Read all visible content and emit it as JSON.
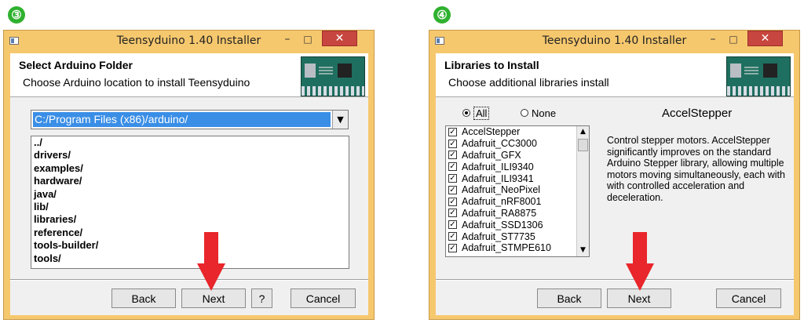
{
  "steps": [
    "③",
    "④"
  ],
  "windows": [
    {
      "title": "Teensyduino 1.40 Installer",
      "controls": {
        "minimize": "–",
        "maximize": "□",
        "close": "✕"
      },
      "header_title": "Select Arduino Folder",
      "header_subtitle": "Choose Arduino location to install Teensyduino",
      "path_value": "C:/Program Files (x86)/arduino/",
      "dropdown_arrow": "▼",
      "folders": [
        "../",
        "drivers/",
        "examples/",
        "hardware/",
        "java/",
        "lib/",
        "libraries/",
        "reference/",
        "tools-builder/",
        "tools/"
      ],
      "buttons": {
        "back": "Back",
        "next": "Next",
        "help": "?",
        "cancel": "Cancel"
      }
    },
    {
      "title": "Teensyduino 1.40 Installer",
      "controls": {
        "minimize": "–",
        "maximize": "□",
        "close": "✕"
      },
      "header_title": "Libraries to Install",
      "header_subtitle": "Choose additional libraries install",
      "radio_all": "All",
      "radio_none": "None",
      "selected_radio": "All",
      "selected_library": "AccelStepper",
      "libraries": [
        "AccelStepper",
        "Adafruit_CC3000",
        "Adafruit_GFX",
        "Adafruit_ILI9340",
        "Adafruit_ILI9341",
        "Adafruit_NeoPixel",
        "Adafruit_nRF8001",
        "Adafruit_RA8875",
        "Adafruit_SSD1306",
        "Adafruit_ST7735",
        "Adafruit_STMPE610"
      ],
      "check_mark": "✓",
      "scroll_up": "▲",
      "scroll_down": "▼",
      "description": "Control stepper motors. AccelStepper significantly improves on the standard Arduino Stepper library, allowing multiple motors moving simultaneously, each with with controlled acceleration and deceleration.",
      "buttons": {
        "back": "Back",
        "next": "Next",
        "cancel": "Cancel"
      }
    }
  ],
  "colors": {
    "frame": "#f6c86e",
    "close": "#c7463f",
    "selection": "#3a8ee6",
    "arrow": "#e8262b",
    "step": "#2fb12f"
  }
}
